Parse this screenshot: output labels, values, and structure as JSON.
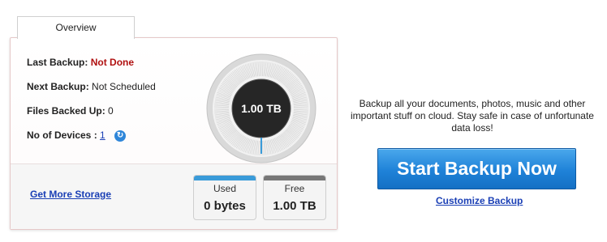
{
  "tabs": [
    {
      "label": "Overview"
    }
  ],
  "status": {
    "last_backup_label": "Last Backup:",
    "last_backup_value": "Not Done",
    "next_backup_label": "Next Backup:",
    "next_backup_value": "Not Scheduled",
    "files_label": "Files Backed Up:",
    "files_value": "0",
    "devices_label": "No of Devices :",
    "devices_value": "1",
    "refresh_icon": "refresh-icon"
  },
  "gauge": {
    "value_label": "1.00 TB",
    "used_fraction": 0.0
  },
  "storage": {
    "more_link": "Get More Storage",
    "used_caption": "Used",
    "used_value": "0 bytes",
    "used_color": "#3a9bd9",
    "free_caption": "Free",
    "free_value": "1.00 TB",
    "free_color": "#777777"
  },
  "promo": {
    "tagline": "Backup all your documents, photos, music and other important stuff on cloud. Stay safe in case of unfortunate data loss!",
    "start_button": "Start Backup Now",
    "customize_link": "Customize Backup"
  },
  "colors": {
    "accent": "#1f82d8",
    "link": "#1a3fb5",
    "alert": "#b01010"
  }
}
